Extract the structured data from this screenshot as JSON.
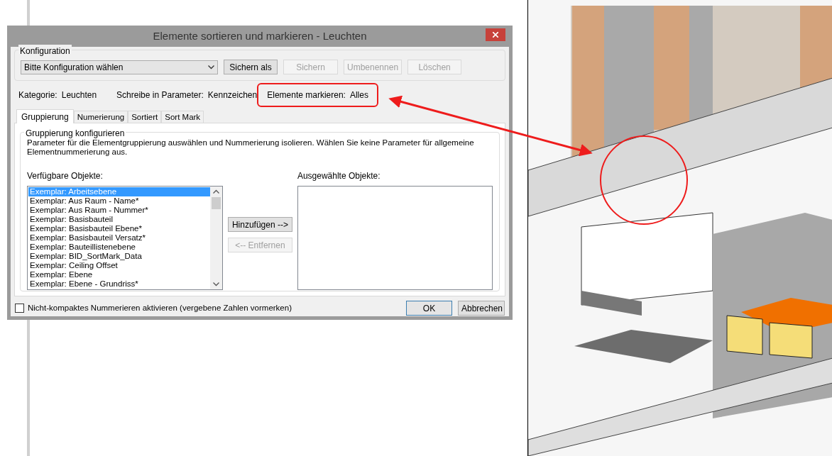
{
  "dialog": {
    "title": "Elemente sortieren und markieren - Leuchten",
    "configuration": {
      "label": "Konfiguration",
      "select_value": "Bitte Konfiguration wählen",
      "buttons": [
        {
          "label": "Sichern als",
          "disabled": false
        },
        {
          "label": "Sichern",
          "disabled": true
        },
        {
          "label": "Umbenennen",
          "disabled": true
        },
        {
          "label": "Löschen",
          "disabled": true
        }
      ]
    },
    "info": [
      {
        "label": "Kategorie:",
        "value": "Leuchten",
        "highlighted": false
      },
      {
        "label": "Schreibe in Parameter:",
        "value": "Kennzeichen",
        "highlighted": false
      },
      {
        "label": "Elemente markieren:",
        "value": "Alles",
        "highlighted": true
      }
    ],
    "tabs": [
      {
        "label": "Gruppierung",
        "selected": true
      },
      {
        "label": "Numerierung",
        "selected": false
      },
      {
        "label": "Sortiert",
        "selected": false
      },
      {
        "label": "Sort Mark",
        "selected": false
      }
    ],
    "group": {
      "title": "Gruppierung konfigurieren",
      "description": "Parameter für die Elementgruppierung auswählen und Nummerierung isolieren. Wählen Sie keine Parameter für allgemeine Elementnummerierung aus.",
      "available": {
        "label": "Verfügbare Objekte:",
        "items": [
          {
            "label": "Exemplar: Arbeitsebene",
            "selected": true
          },
          {
            "label": "Exemplar: Aus Raum - Name*",
            "selected": false
          },
          {
            "label": "Exemplar: Aus Raum - Nummer*",
            "selected": false
          },
          {
            "label": "Exemplar: Basisbauteil",
            "selected": false
          },
          {
            "label": "Exemplar: Basisbauteil Ebene*",
            "selected": false
          },
          {
            "label": "Exemplar: Basisbauteil Versatz*",
            "selected": false
          },
          {
            "label": "Exemplar: Bauteillistenebene",
            "selected": false
          },
          {
            "label": "Exemplar: BID_SortMark_Data",
            "selected": false
          },
          {
            "label": "Exemplar: Ceiling Offset",
            "selected": false
          },
          {
            "label": "Exemplar: Ebene",
            "selected": false
          },
          {
            "label": "Exemplar: Ebene - Grundriss*",
            "selected": false
          }
        ]
      },
      "move_buttons": [
        {
          "label": "Hinzufügen -->",
          "disabled": false
        },
        {
          "label": "<-- Entfernen",
          "disabled": true
        }
      ],
      "chosen": {
        "label": "Ausgewählte Objekte:"
      }
    },
    "checkbox": {
      "label": "Nicht-kompaktes Nummerieren aktivieren (vergebene Zahlen vormerken)",
      "checked": false
    },
    "buttons": [
      {
        "label": "OK",
        "default": true
      },
      {
        "label": "Abbrechen",
        "default": false
      }
    ]
  }
}
